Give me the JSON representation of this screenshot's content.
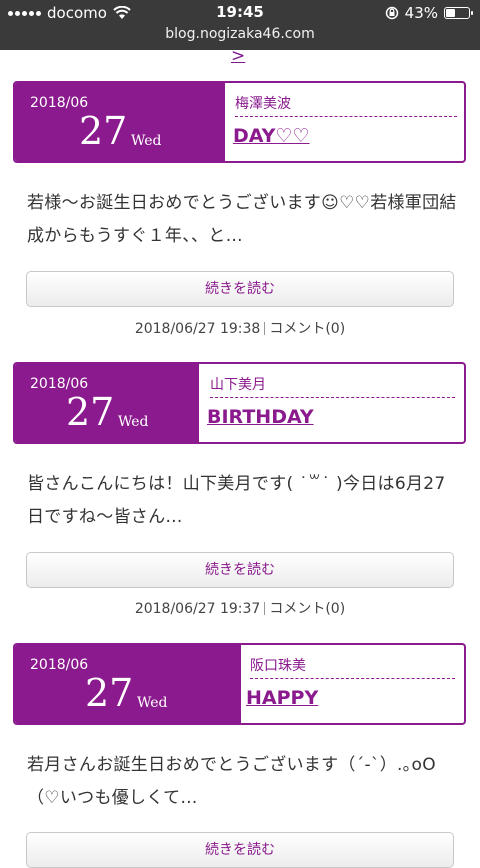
{
  "status": {
    "carrier": "docomo",
    "time": "19:45",
    "battery": "43%",
    "battery_level": 0.43
  },
  "url": "blog.nogizaka46.com",
  "next_link": ">",
  "entries": [
    {
      "year_month": "2018/06",
      "day": "27",
      "weekday": "Wed",
      "author": "梅澤美波",
      "title": "DAY♡♡",
      "excerpt": "若様〜お誕生日おめでとうございます☺♡♡若様軍団結成からもうすぐ１年、、と…",
      "more_label": "続きを読む",
      "posted": "2018/06/27 19:38",
      "comments": "コメント(0)"
    },
    {
      "year_month": "2018/06",
      "day": "27",
      "weekday": "Wed",
      "author": "山下美月",
      "title": "BIRTHDAY",
      "excerpt": "皆さんこんにちは！山下美月です( ˙꒳˙ )今日は6月27日ですね〜皆さん…",
      "more_label": "続きを読む",
      "posted": "2018/06/27 19:37",
      "comments": "コメント(0)"
    },
    {
      "year_month": "2018/06",
      "day": "27",
      "weekday": "Wed",
      "author": "阪口珠美",
      "title": "HAPPY",
      "excerpt": " 若月さんお誕生日おめでとうございます（´-`）.｡oO（♡いつも優しくて…",
      "more_label": "続きを読む",
      "posted": "",
      "comments": ""
    }
  ]
}
